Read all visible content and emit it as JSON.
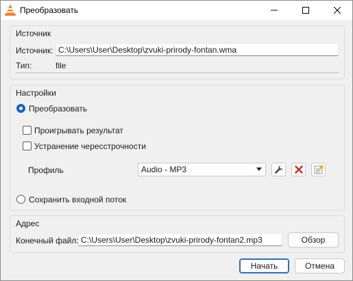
{
  "window": {
    "title": "Преобразовать"
  },
  "source": {
    "group_title": "Источник",
    "source_label": "Источник:",
    "source_value": "C:\\Users\\User\\Desktop\\zvuki-prirody-fontan.wma",
    "type_label": "Тип:",
    "type_value": "file"
  },
  "settings": {
    "group_title": "Настройки",
    "convert_radio": {
      "label": "Преобразовать",
      "checked": true
    },
    "play_result": {
      "label": "Проигрывать результат",
      "checked": false
    },
    "deinterlace": {
      "label": "Устранение чересстрочности",
      "checked": false
    },
    "profile_label": "Профиль",
    "profile_selected": "Audio - MP3",
    "save_raw_radio": {
      "label": "Сохранить входной поток",
      "checked": false
    }
  },
  "destination": {
    "group_title": "Адрес",
    "file_label": "Конечный файл:",
    "file_value": "C:\\Users\\User\\Desktop\\zvuki-prirody-fontan2.mp3",
    "browse_label": "Обзор"
  },
  "footer": {
    "start_label": "Начать",
    "cancel_label": "Отмена"
  },
  "icons": {
    "app": "vlc-cone-icon",
    "edit_profile": "wrench-icon",
    "delete_profile": "red-x-icon",
    "new_profile": "new-profile-icon"
  }
}
